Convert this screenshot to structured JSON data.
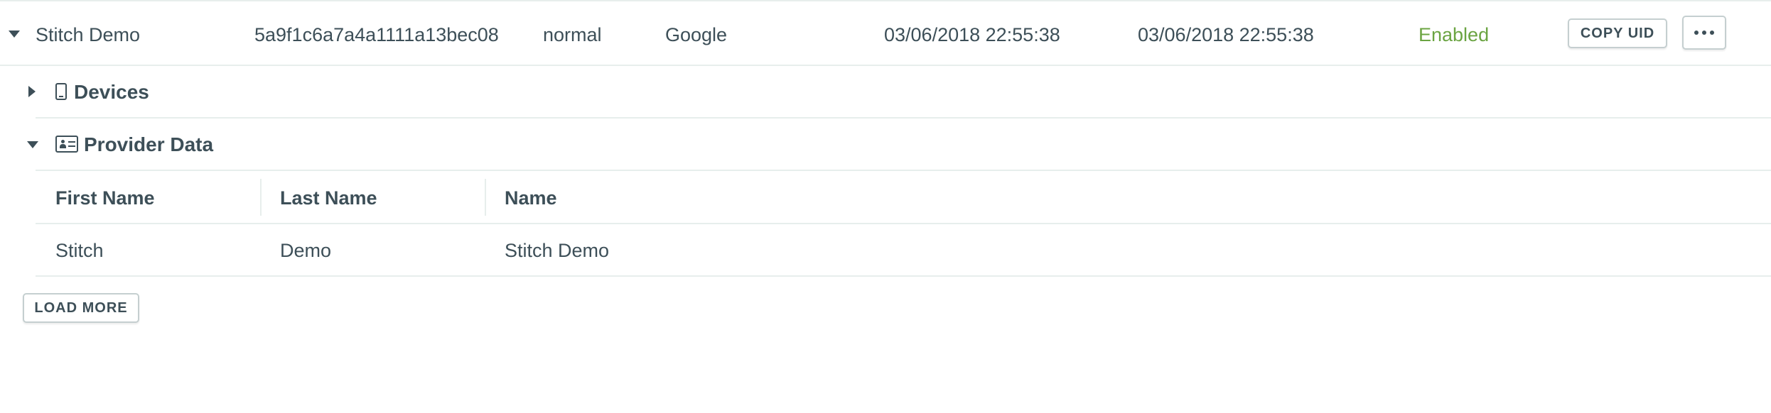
{
  "user": {
    "name": "Stitch Demo",
    "uid": "5a9f1c6a7a4a1111a13bec08",
    "type": "normal",
    "provider": "Google",
    "created": "03/06/2018 22:55:38",
    "last_login": "03/06/2018 22:55:38",
    "status": "Enabled",
    "copy_uid_label": "COPY UID"
  },
  "colors": {
    "status_enabled": "#6ba442",
    "text": "#3d4f58",
    "divider": "#e7eeec"
  },
  "sections": {
    "devices": {
      "title": "Devices",
      "icon": "phone-icon",
      "expanded": false
    },
    "provider_data": {
      "title": "Provider Data",
      "icon": "id-card-icon",
      "expanded": true
    }
  },
  "provider_table": {
    "headers": [
      "First Name",
      "Last Name",
      "Name"
    ],
    "rows": [
      [
        "Stitch",
        "Demo",
        "Stitch Demo"
      ]
    ]
  },
  "load_more_label": "LOAD MORE"
}
